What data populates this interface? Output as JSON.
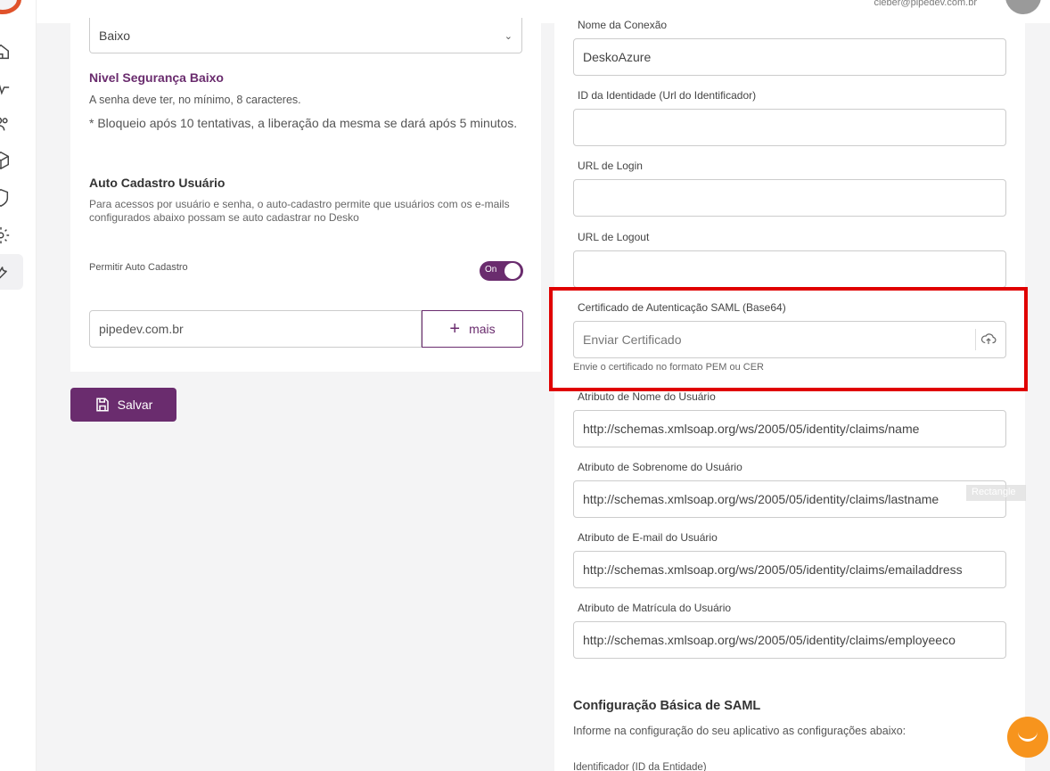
{
  "user": {
    "email": "cleber@pipedev.com.br"
  },
  "left": {
    "security_level_value": "Baixo",
    "security_title": "Nivel Segurança Baixo",
    "security_min_chars": "A senha deve ter, no mínimo, 8 caracteres.",
    "security_block": "* Bloqueio após 10 tentativas, a liberação da mesma se dará após 5 minutos.",
    "auto_title": "Auto Cadastro Usuário",
    "auto_desc": "Para acessos por usuário e senha, o auto-cadastro permite que usuários com os e-mails configurados abaixo possam se auto cadastrar no Desko",
    "permit_label": "Permitir Auto Cadastro",
    "toggle_text": "On",
    "domain_value": "pipedev.com.br",
    "more_label": "mais",
    "save_label": "Salvar"
  },
  "right": {
    "fields": [
      {
        "label": "Nome da Conexão",
        "value": "DeskoAzure"
      },
      {
        "label": "ID da Identidade (Url do Identificador)",
        "value": ""
      },
      {
        "label": "URL de Login",
        "value": ""
      },
      {
        "label": "URL de Logout",
        "value": ""
      }
    ],
    "cert_label": "Certificado de Autenticação SAML (Base64)",
    "cert_placeholder": "Enviar Certificado",
    "cert_hint": "Envie o certificado no formato PEM ou CER",
    "attrs": [
      {
        "label": "Atributo de Nome do Usuário",
        "value": "http://schemas.xmlsoap.org/ws/2005/05/identity/claims/name"
      },
      {
        "label": "Atributo de Sobrenome do Usuário",
        "value": "http://schemas.xmlsoap.org/ws/2005/05/identity/claims/lastname"
      },
      {
        "label": "Atributo de E-mail do Usuário",
        "value": "http://schemas.xmlsoap.org/ws/2005/05/identity/claims/emailaddress"
      },
      {
        "label": "Atributo de Matrícula do Usuário",
        "value": "http://schemas.xmlsoap.org/ws/2005/05/identity/claims/employeeco"
      }
    ],
    "saml_title": "Configuração Básica de SAML",
    "saml_desc": "Informe na configuração do seu aplicativo as configurações abaixo:",
    "saml_id_label": "Identificador (ID da Entidade)"
  },
  "overlay": {
    "rect_tag": "Rectangle"
  },
  "icons": [
    "home-icon",
    "activity-icon",
    "users-icon",
    "box-icon",
    "shield-icon",
    "gear-icon",
    "tools-icon",
    "upload-cloud-icon",
    "save-icon",
    "chat-icon"
  ],
  "colors": {
    "brand": "#6a2c6e",
    "highlight": "#e00000",
    "chat": "#f7941d"
  }
}
